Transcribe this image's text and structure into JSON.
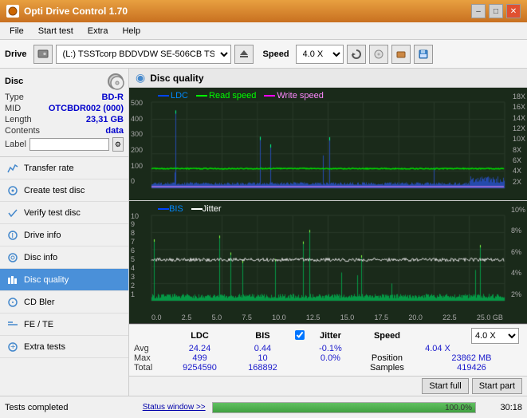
{
  "app": {
    "title": "Opti Drive Control 1.70",
    "icon": "ODC"
  },
  "titlebar": {
    "title": "Opti Drive Control 1.70",
    "minimize": "–",
    "maximize": "□",
    "close": "✕"
  },
  "menubar": {
    "items": [
      "File",
      "Start test",
      "Extra",
      "Help"
    ]
  },
  "toolbar": {
    "drive_label": "Drive",
    "drive_value": "(L:) TSSTcorp BDDVDW SE-506CB TS02",
    "speed_label": "Speed",
    "speed_value": "4.0 X"
  },
  "disc": {
    "title": "Disc",
    "type_label": "Type",
    "type_value": "BD-R",
    "mid_label": "MID",
    "mid_value": "OTCBDR002 (000)",
    "length_label": "Length",
    "length_value": "23,31 GB",
    "contents_label": "Contents",
    "contents_value": "data",
    "label_label": "Label",
    "label_value": ""
  },
  "nav": {
    "items": [
      {
        "id": "transfer-rate",
        "label": "Transfer rate",
        "icon": "chart"
      },
      {
        "id": "create-test-disc",
        "label": "Create test disc",
        "icon": "disc"
      },
      {
        "id": "verify-test-disc",
        "label": "Verify test disc",
        "icon": "check"
      },
      {
        "id": "drive-info",
        "label": "Drive info",
        "icon": "info"
      },
      {
        "id": "disc-info",
        "label": "Disc info",
        "icon": "disc-info"
      },
      {
        "id": "disc-quality",
        "label": "Disc quality",
        "icon": "quality",
        "active": true
      },
      {
        "id": "cd-bler",
        "label": "CD Bler",
        "icon": "cd"
      },
      {
        "id": "fe-te",
        "label": "FE / TE",
        "icon": "fe"
      },
      {
        "id": "extra-tests",
        "label": "Extra tests",
        "icon": "extra"
      }
    ]
  },
  "chart": {
    "title": "Disc quality",
    "top_legend": [
      "LDC",
      "Read speed",
      "Write speed"
    ],
    "top_legend_colors": [
      "#0044cc",
      "#00cc00",
      "#ff00ff"
    ],
    "bottom_legend": [
      "BIS",
      "Jitter"
    ],
    "bottom_legend_colors": [
      "#0044cc",
      "#ffffff"
    ],
    "top_yaxis_right": [
      "18X",
      "16X",
      "14X",
      "12X",
      "10X",
      "8X",
      "6X",
      "4X",
      "2X"
    ],
    "top_yaxis_left": [
      "500",
      "400",
      "300",
      "200",
      "100",
      "0.0"
    ],
    "xaxis": [
      "0.0",
      "2.5",
      "5.0",
      "7.5",
      "10.0",
      "12.5",
      "15.0",
      "17.5",
      "20.0",
      "22.5",
      "25.0 GB"
    ],
    "bottom_yaxis_right": [
      "10%",
      "8%",
      "6%",
      "4%",
      "2%"
    ],
    "bottom_yaxis_left": [
      "10",
      "9",
      "8",
      "7",
      "6",
      "5",
      "4",
      "3",
      "2",
      "1"
    ]
  },
  "stats": {
    "col_headers": [
      "",
      "LDC",
      "BIS",
      "",
      "Jitter",
      "Speed",
      ""
    ],
    "rows": [
      {
        "label": "Avg",
        "ldc": "24.24",
        "bis": "0.44",
        "jitter": "-0.1%",
        "speed": "4.04 X"
      },
      {
        "label": "Max",
        "ldc": "499",
        "bis": "10",
        "jitter": "0.0%",
        "position": "23862 MB"
      },
      {
        "label": "Total",
        "ldc": "9254590",
        "bis": "168892",
        "samples": "419426"
      }
    ],
    "jitter_checked": true,
    "speed_value": "4.0 X",
    "position_label": "Position",
    "samples_label": "Samples"
  },
  "buttons": {
    "start_full": "Start full",
    "start_part": "Start part"
  },
  "statusbar": {
    "status": "Tests completed",
    "progress": 100,
    "progress_text": "100.0%",
    "time": "30:18"
  },
  "status_window_btn": "Status window >>"
}
